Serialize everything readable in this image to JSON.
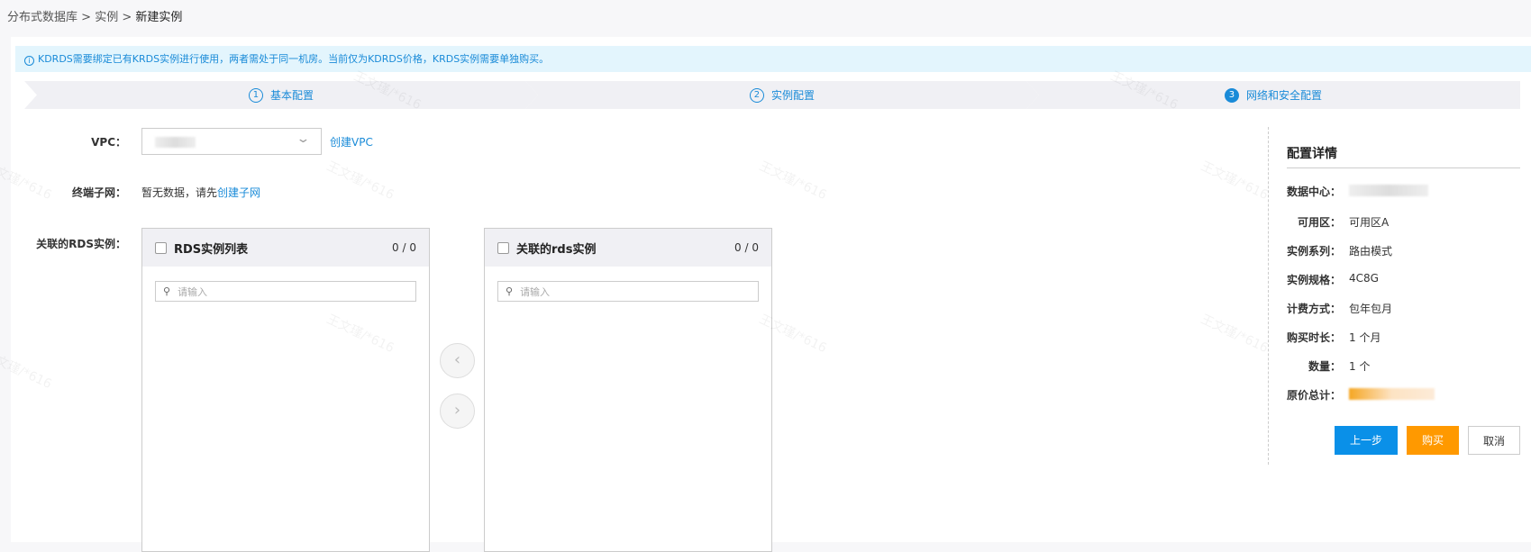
{
  "breadcrumb": {
    "items": [
      "分布式数据库",
      "实例"
    ],
    "sep": ">",
    "current": "新建实例"
  },
  "alert": {
    "icon": "info-icon",
    "text": "KDRDS需要绑定已有KRDS实例进行使用，两者需处于同一机房。当前仅为KDRDS价格，KRDS实例需要单独购买。"
  },
  "steps": [
    {
      "num": "1",
      "label": "基本配置"
    },
    {
      "num": "2",
      "label": "实例配置"
    },
    {
      "num": "3",
      "label": "网络和安全配置",
      "active": true
    }
  ],
  "form": {
    "vpc_label": "VPC：",
    "create_vpc": "创建VPC",
    "subnet_label": "终端子网：",
    "subnet_empty": "暂无数据，请先",
    "create_subnet": "创建子网",
    "rds_label": "关联的RDS实例："
  },
  "transfer": {
    "left": {
      "title": "RDS实例列表",
      "count": "0 / 0",
      "placeholder": "请输入"
    },
    "right": {
      "title": "关联的rds实例",
      "count": "0 / 0",
      "placeholder": "请输入"
    }
  },
  "summary": {
    "title": "配置详情",
    "rows": [
      {
        "label": "数据中心：",
        "value": ""
      },
      {
        "label": "可用区：",
        "value": "可用区A"
      },
      {
        "label": "实例系列：",
        "value": "路由模式"
      },
      {
        "label": "实例规格：",
        "value": "4C8G"
      },
      {
        "label": "计费方式：",
        "value": "包年包月"
      },
      {
        "label": "购买时长：",
        "value": "1 个月"
      },
      {
        "label": "数量：",
        "value": "1 个"
      },
      {
        "label": "原价总计：",
        "value": ""
      }
    ]
  },
  "buttons": {
    "prev": "上一步",
    "buy": "购买",
    "cancel": "取消"
  },
  "colors": {
    "primary": "#0a90e8",
    "buy": "#ff9900",
    "price": "#f5a623"
  },
  "watermark": "王文瑾/*616"
}
